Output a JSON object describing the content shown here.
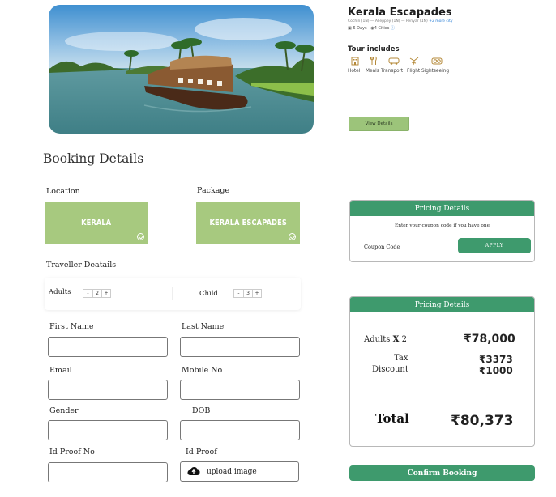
{
  "tour": {
    "title": "Kerala Escapades",
    "route": "Cochin (1N) — Alleppey (1N) — Periyar (1N) ",
    "route_more": "+2 more city",
    "days": "6 Days",
    "cities": "4 Cities",
    "includes_title": "Tour includes",
    "includes": [
      {
        "label": "Hotel",
        "icon": "hotel-icon"
      },
      {
        "label": "Meals",
        "icon": "meals-icon"
      },
      {
        "label": "Transport",
        "icon": "transport-icon"
      },
      {
        "label": "Flight",
        "icon": "flight-icon"
      },
      {
        "label": "Sightseeing",
        "icon": "sightseeing-icon"
      }
    ],
    "view_details": "View Details"
  },
  "booking": {
    "title": "Booking Details",
    "location_label": "Location",
    "location_value": "KERALA",
    "package_label": "Package",
    "package_value": "KERALA ESCAPADES",
    "traveller_label": "Traveller Deatails",
    "adults_label": "Adults",
    "adults_count": "2",
    "child_label": "Child",
    "child_count": "3",
    "minus": "-",
    "plus": "+",
    "first_name": "First Name",
    "last_name": "Last Name",
    "email": "Email",
    "mobile": "Mobile No",
    "gender": "Gender",
    "dob": "DOB",
    "id_proof_no": "Id Proof No",
    "id_proof": "Id Proof",
    "upload": "upload image"
  },
  "coupon_card": {
    "title": "Pricing Details",
    "hint": "Enter your coupon code if you have one",
    "label": "Coupon Code",
    "apply": "APPLY"
  },
  "pricing": {
    "title": "Pricing Details",
    "adults_label": "Adults",
    "times": "X",
    "adults_qty": "2",
    "adults_amount": "₹78,000",
    "tax_label": "Tax",
    "tax_amount": "₹3373",
    "discount_label": "Discount",
    "discount_amount": "₹1000",
    "total_label": "Total",
    "total_amount": "₹80,373"
  },
  "confirm": "Confirm Booking",
  "colors": {
    "accent": "#3e9a6d",
    "tile": "#a7c97f",
    "view_button": "#9cc47a"
  }
}
